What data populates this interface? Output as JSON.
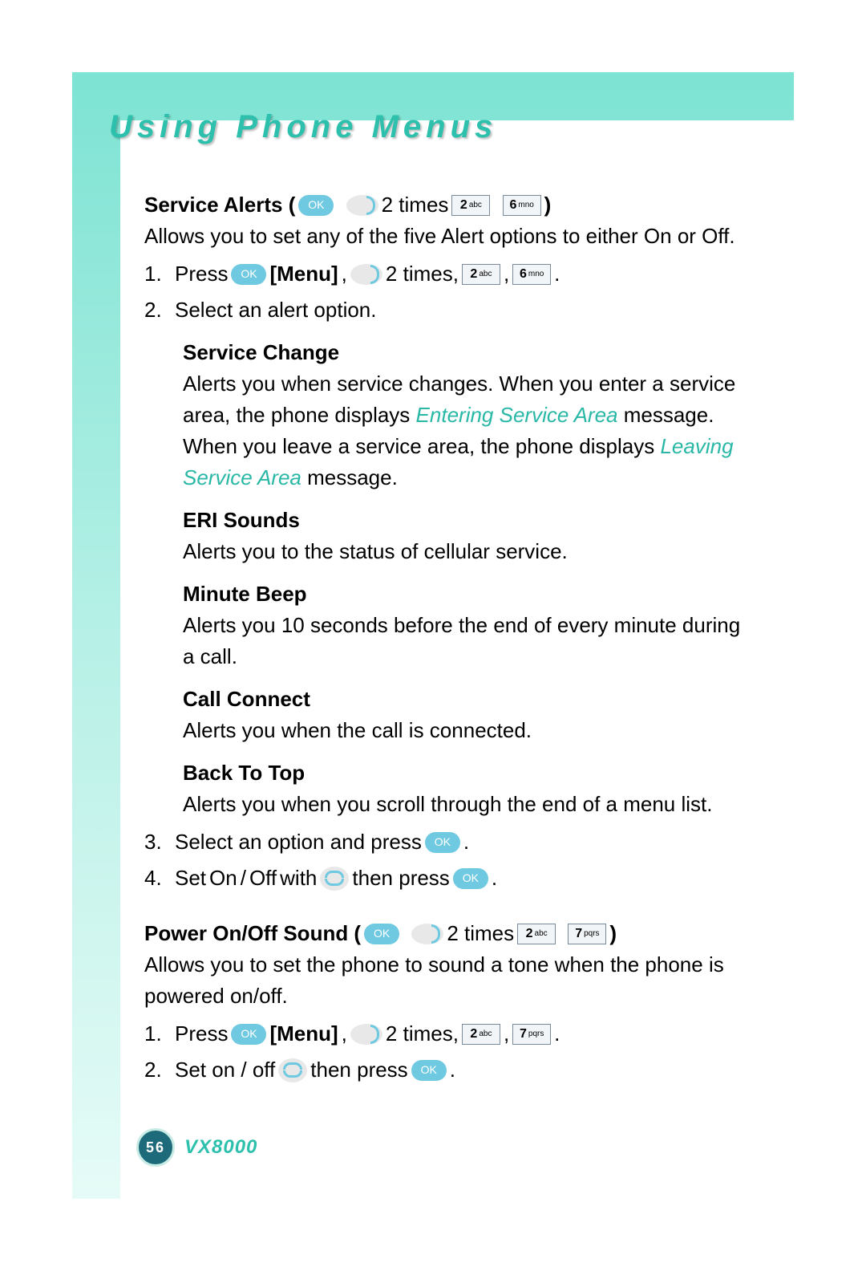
{
  "title": "Using Phone Menus",
  "page_number": "56",
  "model": "VX8000",
  "service_alerts": {
    "heading": "Service Alerts (",
    "times": " 2 times ",
    "close": " )",
    "intro_a": "Allows you to set any of the five Alert options to either ",
    "on": "On",
    "or": " or ",
    "off": "Off",
    "period": ".",
    "step1_num": "1.",
    "step1_a": "Press ",
    "step1_menu": " [Menu]",
    "step1_b": ", ",
    "step1_c": " 2 times, ",
    "step1_d": " , ",
    "step1_e": " .",
    "step2_num": "2.",
    "step2": "Select an alert option.",
    "svc_change_h": "Service Change",
    "svc_change_a": "Alerts you when service changes. When you enter a service area, the phone displays ",
    "svc_change_msg1": "Entering Service Area",
    "svc_change_b": " message. When you leave a service area, the phone displays ",
    "svc_change_msg2": "Leaving Service Area",
    "svc_change_c": " message.",
    "eri_h": "ERI Sounds",
    "eri_body": "Alerts you to the status of cellular service.",
    "min_h": "Minute Beep",
    "min_body": "Alerts you 10 seconds before the end of every minute during a call.",
    "cc_h": "Call Connect",
    "cc_body": "Alerts you when the call is connected.",
    "btt_h": "Back To Top",
    "btt_body": "Alerts you when you scroll through the end of a menu list.",
    "step3_num": "3.",
    "step3_a": "Select an option and press ",
    "step3_b": " .",
    "step4_num": "4.",
    "step4_a": "Set ",
    "step4_on": "On",
    "step4_slash": " / ",
    "step4_off": "Off",
    "step4_b": "  with ",
    "step4_c": " then press ",
    "step4_d": " ."
  },
  "power": {
    "heading": "Power On/Off Sound (",
    "times": " 2 times ",
    "close": " )",
    "intro": "Allows you to set the phone to sound a tone when the phone is powered on/off.",
    "step1_num": "1.",
    "step1_a": "Press ",
    "step1_menu": " [Menu]",
    "step1_b": ", ",
    "step1_c": " 2 times, ",
    "step1_d": " , ",
    "step1_e": " .",
    "step2_num": "2.",
    "step2_a": "Set on / off ",
    "step2_b": " then press ",
    "step2_c": " ."
  },
  "keys": {
    "ok": "OK",
    "k2n": "2",
    "k2t": "abc",
    "k6n": "6",
    "k6t": "mno",
    "k7n": "7",
    "k7t": "pqrs"
  }
}
